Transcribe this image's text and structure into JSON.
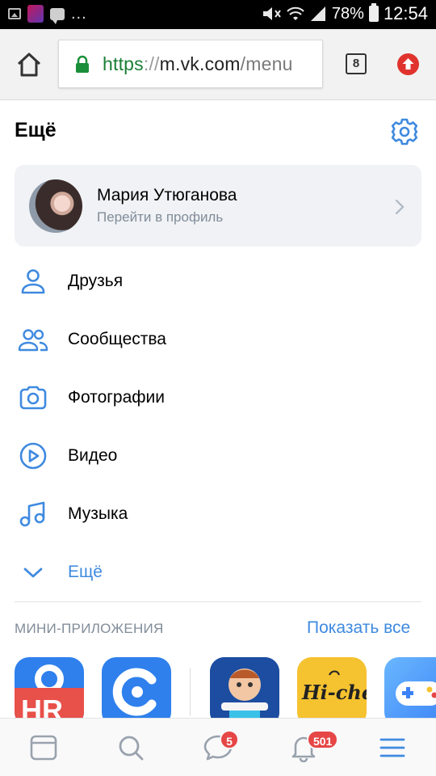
{
  "status_bar": {
    "battery": "78%",
    "time": "12:54",
    "overflow": "..."
  },
  "browser": {
    "url_scheme": "https",
    "url_sep": "://",
    "url_host": "m.vk.com",
    "url_path": "/menu",
    "tab_count": "8"
  },
  "page": {
    "title": "Ещё"
  },
  "profile": {
    "name": "Мария Утюганова",
    "subtitle": "Перейти в профиль"
  },
  "menu": {
    "items": [
      {
        "label": "Друзья",
        "icon": "user-icon"
      },
      {
        "label": "Сообщества",
        "icon": "users-icon"
      },
      {
        "label": "Фотографии",
        "icon": "camera-icon"
      },
      {
        "label": "Видео",
        "icon": "play-icon"
      },
      {
        "label": "Музыка",
        "icon": "music-icon"
      },
      {
        "label": "Ещё",
        "icon": "chevron-down-icon"
      }
    ]
  },
  "mini_apps": {
    "title": "МИНИ-ПРИЛОЖЕНИЯ",
    "show_all": "Показать все",
    "apps": [
      {
        "icon": "hr-app-icon",
        "label": "HR"
      },
      {
        "icon": "c-app-icon"
      },
      {
        "icon": "baby-app-icon"
      },
      {
        "icon": "chef-app-icon",
        "label": "Hi-chef"
      },
      {
        "icon": "gamepad-app-icon"
      }
    ]
  },
  "tabbar": {
    "messages_badge": "5",
    "notifications_badge": "501"
  },
  "colors": {
    "accent": "#3f8ae0",
    "secondary_text": "#818c99",
    "badge": "#e64646",
    "card_bg": "#f0f2f5"
  }
}
